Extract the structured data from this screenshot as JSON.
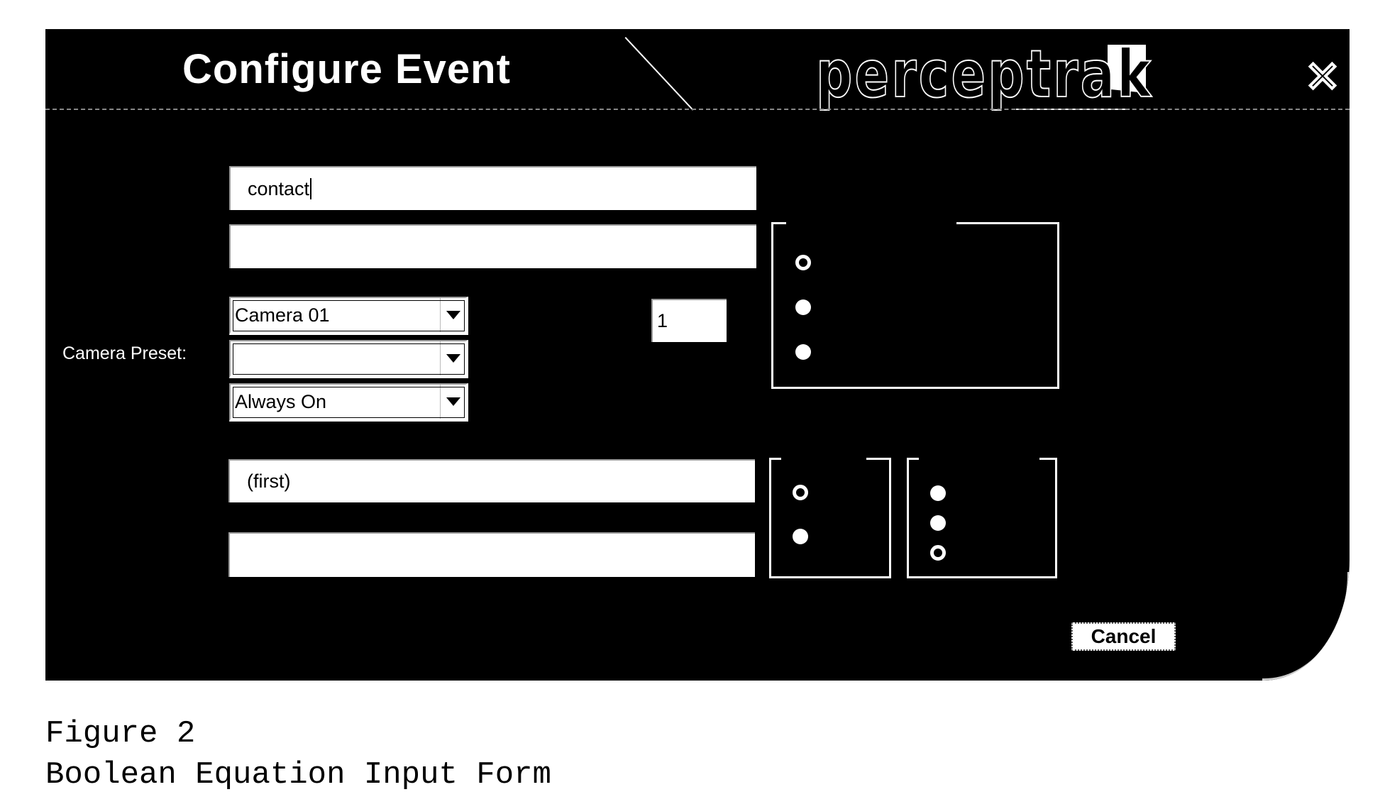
{
  "dialog": {
    "title": "Configure Event",
    "logo_text": "perceptrak",
    "close_icon": "close-x-icon",
    "close_glyph": "✕"
  },
  "form": {
    "event_name_input": {
      "value": "contact",
      "placeholder": ""
    },
    "second_input": {
      "value": "",
      "placeholder": ""
    },
    "camera_select": {
      "selected": "Camera 01"
    },
    "camera_preset_label": "Camera Preset:",
    "camera_preset_select": {
      "selected": ""
    },
    "schedule_select": {
      "selected": "Always On"
    },
    "number_field": {
      "value": "1"
    },
    "top_radio_group": {
      "options": [
        "",
        "",
        ""
      ],
      "selected_index": 0
    },
    "equation_input": {
      "value": "(first)",
      "placeholder": ""
    },
    "fourth_input": {
      "value": "",
      "placeholder": ""
    },
    "bottom_left_radio_group": {
      "options": [
        "",
        ""
      ],
      "selected_index": 0
    },
    "bottom_right_radio_group": {
      "options": [
        "",
        "",
        ""
      ],
      "selected_index": 2
    },
    "cancel_label": "Cancel"
  },
  "caption": {
    "line1": "Figure 2",
    "line2": "Boolean Equation Input Form"
  }
}
